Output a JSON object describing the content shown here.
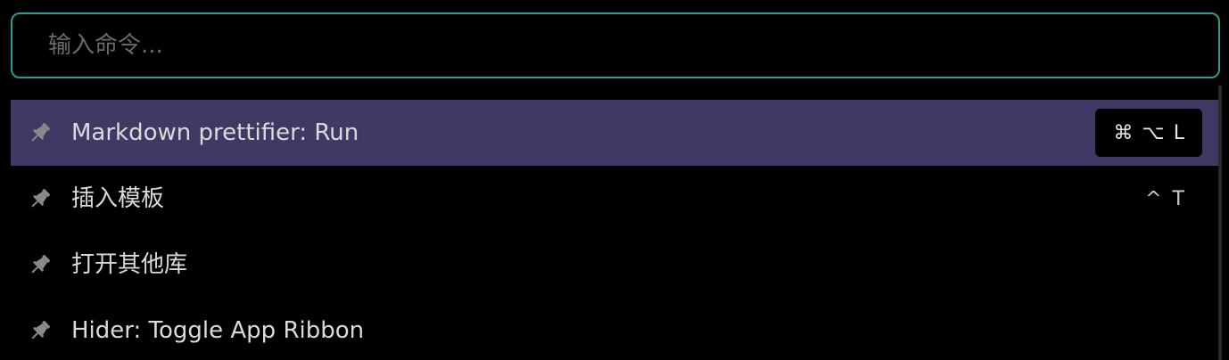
{
  "search": {
    "placeholder": "输入命令...",
    "value": ""
  },
  "commands": [
    {
      "label": "Markdown prettifier: Run",
      "icon": "pin-icon",
      "hotkey": [
        "⌘",
        "⌥",
        "L"
      ],
      "selected": true
    },
    {
      "label": "插入模板",
      "icon": "pin-icon",
      "hotkey": [
        "^",
        "T"
      ],
      "selected": false
    },
    {
      "label": "打开其他库",
      "icon": "pin-icon",
      "hotkey": [],
      "selected": false
    },
    {
      "label": "Hider: Toggle App Ribbon",
      "icon": "pin-icon",
      "hotkey": [],
      "selected": false
    }
  ],
  "colors": {
    "accent_border": "#2a9d8f",
    "selected_row": "#3e3a63",
    "background": "#000000"
  }
}
